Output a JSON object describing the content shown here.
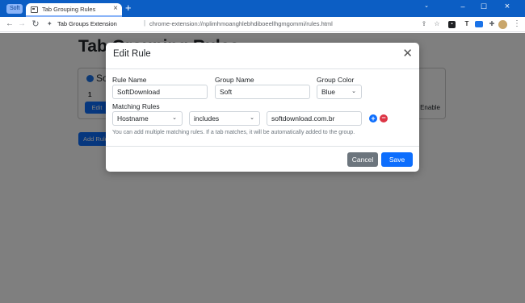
{
  "browser": {
    "tab_group_label": "Soft",
    "tab_title": "Tab Grouping Rules",
    "address_origin": "Tab Groups Extension",
    "address_separator": "|",
    "address_url": "chrome-extension://nplimhmoanghlebhdiboeellhgmgommi/rules.html",
    "new_tab_glyph": "+",
    "icons": [
      "back-icon",
      "forward-icon",
      "reload-icon",
      "puzzle-icon",
      "share-icon",
      "star-icon",
      "menu-icon"
    ]
  },
  "page": {
    "title": "Tab Grouping Rules",
    "card": {
      "group_name": "So",
      "count": "1",
      "edit_label": "Edit",
      "enable_label": "Enable"
    },
    "add_rule_label": "Add Rule"
  },
  "modal": {
    "title": "Edit Rule",
    "rule_name_label": "Rule Name",
    "rule_name_value": "SoftDownload",
    "group_name_label": "Group Name",
    "group_name_value": "Soft",
    "group_color_label": "Group Color",
    "group_color_value": "Blue",
    "matching_rules_label": "Matching Rules",
    "match_field": "Hostname",
    "match_operator": "includes",
    "match_value": "softdownload.com.br",
    "hint": "You can add multiple matching rules. If a tab matches, it will be automatically added to the group.",
    "cancel_label": "Cancel",
    "save_label": "Save"
  },
  "colors": {
    "accent": "#0d6efd",
    "danger": "#dc3545",
    "secondary": "#6c757d",
    "chrome_frame": "#0c5ec4",
    "group_chip": "#8ab4f8"
  }
}
